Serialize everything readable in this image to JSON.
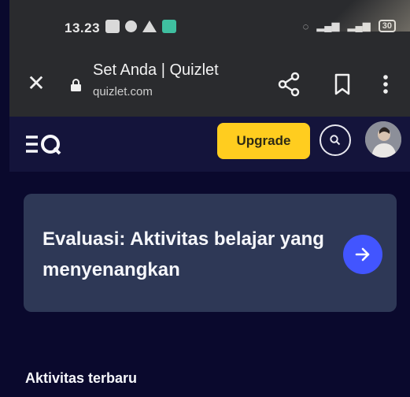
{
  "status_bar": {
    "time": "13.23",
    "left_icons": [
      "mail-icon",
      "settings-icon",
      "warning-icon",
      "app-icon"
    ],
    "right_icons": [
      "hotspot-icon",
      "signal-icon",
      "signal-icon"
    ],
    "battery_label": "30"
  },
  "browser": {
    "page_title": "Set Anda | Quizlet",
    "url": "quizlet.com",
    "close_symbol": "✕",
    "icons": [
      "close-icon",
      "lock-icon",
      "share-icon",
      "bookmark-icon",
      "more-vert-icon"
    ]
  },
  "header": {
    "logo_text": "ΞQ",
    "upgrade_label": "Upgrade",
    "colors": {
      "upgrade_bg": "#ffcd1f",
      "header_bg": "#14143b",
      "page_bg": "#0a092d"
    }
  },
  "eval_card": {
    "text": "Evaluasi: Aktivitas belajar yang menyenangkan",
    "colors": {
      "card_bg": "#2e3856",
      "arrow_bg": "#4255ff"
    }
  },
  "recent": {
    "heading": "Aktivitas terbaru"
  }
}
